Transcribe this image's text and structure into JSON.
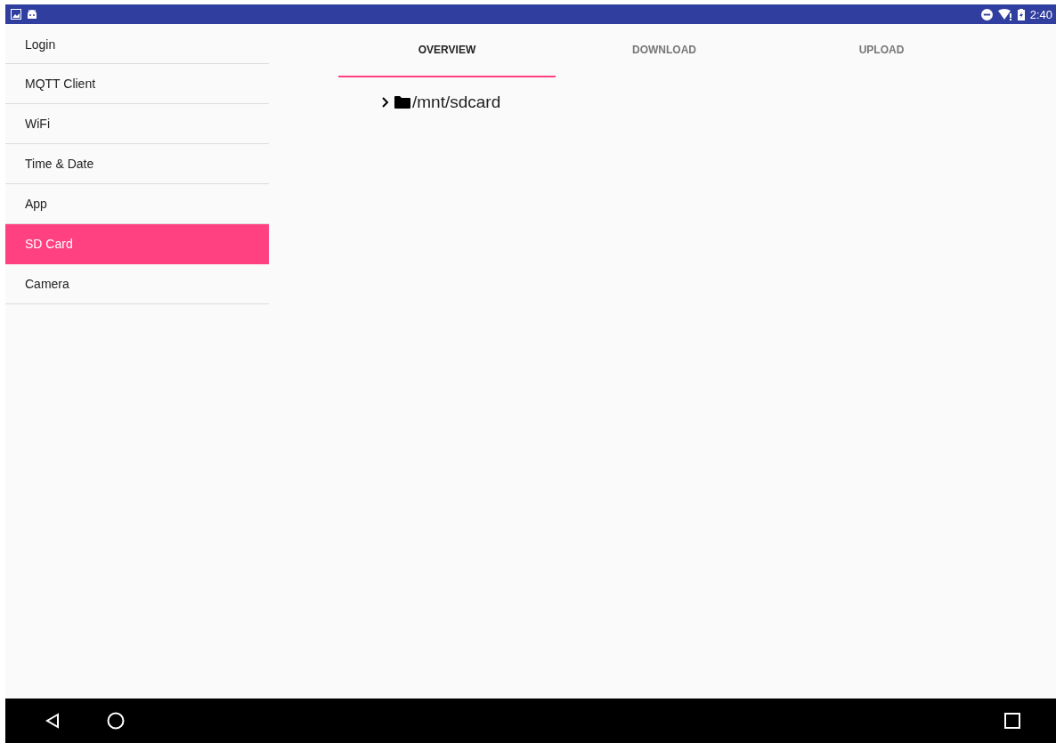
{
  "status_bar": {
    "time": "2:40"
  },
  "sidebar": {
    "items": [
      {
        "label": "Login",
        "selected": false
      },
      {
        "label": "MQTT Client",
        "selected": false
      },
      {
        "label": "WiFi",
        "selected": false
      },
      {
        "label": "Time & Date",
        "selected": false
      },
      {
        "label": "App",
        "selected": false
      },
      {
        "label": "SD Card",
        "selected": true
      },
      {
        "label": "Camera",
        "selected": false
      }
    ]
  },
  "tabs": [
    {
      "label": "OVERVIEW",
      "selected": true
    },
    {
      "label": "DOWNLOAD",
      "selected": false
    },
    {
      "label": "UPLOAD",
      "selected": false
    }
  ],
  "tree": [
    {
      "label": "/mnt/sdcard",
      "expanded": false
    }
  ]
}
